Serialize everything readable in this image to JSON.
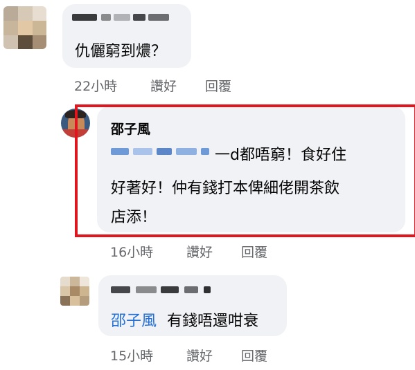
{
  "comments": [
    {
      "author_blurred": true,
      "text": "仇儷窮到燶？",
      "time": "22小時",
      "like_label": "讚好",
      "reply_label": "回覆"
    },
    {
      "author": "邵子風",
      "mention_blurred": true,
      "text_line1": "一d都唔窮！食好住",
      "text_line2": "好著好！仲有錢打本俾細佬開茶飲",
      "text_line3": "店添！",
      "time": "16小時",
      "like_label": "讚好",
      "reply_label": "回覆"
    },
    {
      "author_blurred": true,
      "mention": "邵子風",
      "text": "有錢唔還咁衰",
      "time": "15小時",
      "like_label": "讚好",
      "reply_label": "回覆"
    }
  ],
  "colors": {
    "bubble": "#f0f2f5",
    "action_text": "#65676b",
    "mention": "#216fdb",
    "highlight_box": "#e0161e"
  }
}
